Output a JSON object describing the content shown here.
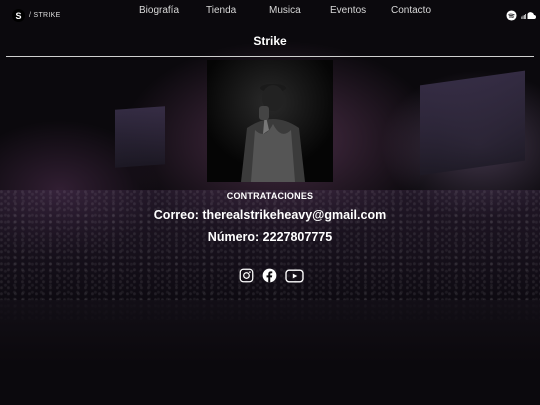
{
  "header": {
    "logo_letter": "S",
    "logo_text": "/ STRIKE",
    "nav": [
      "Biografía",
      "Tienda",
      "Musica",
      "Eventos",
      "Contacto"
    ],
    "social_icons": [
      "spotify-icon",
      "soundcloud-icon"
    ]
  },
  "page": {
    "title": "Strike"
  },
  "contact": {
    "heading": "CONTRATACIONES",
    "email": "Correo: therealstrikeheavy@gmail.com",
    "phone": "Número: 2227807775"
  },
  "footer_social": [
    "instagram-icon",
    "facebook-icon",
    "youtube-icon"
  ],
  "colors": {
    "background": "#0b090d",
    "text": "#ffffff",
    "nav_text": "#d8d8d8",
    "stage_glow": "#9a5a8c"
  }
}
